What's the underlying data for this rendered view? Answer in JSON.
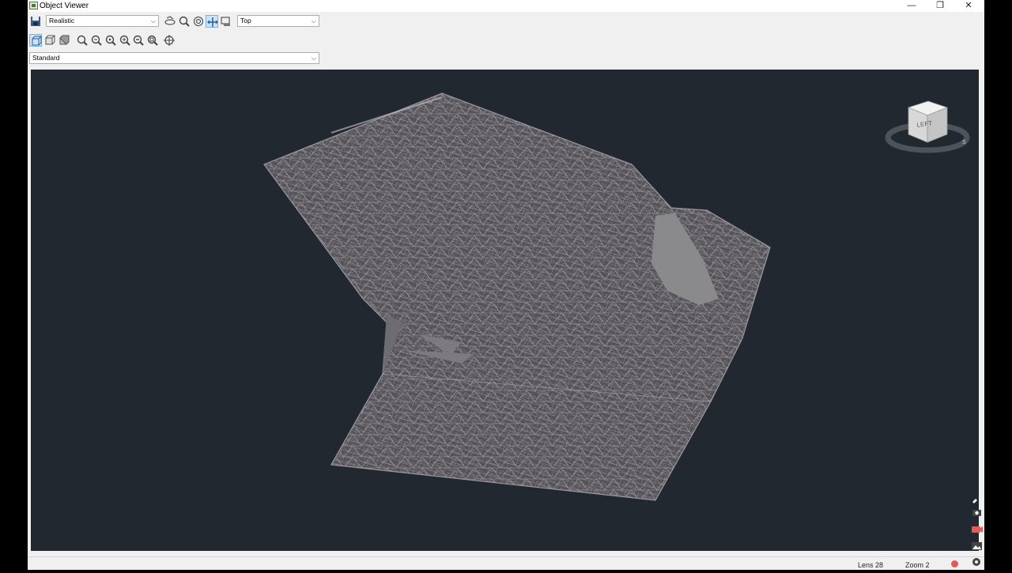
{
  "window": {
    "title": "Object Viewer",
    "controls": {
      "minimize": "—",
      "restore": "❐",
      "close": "✕"
    }
  },
  "toolbar": {
    "visual_style": "Realistic",
    "view": "Top",
    "ucs": "Standard",
    "icons_row1": [
      "save-icon",
      "orbit-icon",
      "zoom-icon",
      "zoom-window-icon",
      "pan-icon",
      "zoom-extents-icon"
    ],
    "icons_row2": [
      "wireframe-box-icon",
      "shaded-box-icon",
      "realistic-box-icon",
      "zoom-realtime-icon",
      "zoom-previous-icon",
      "zoom-dynamic-icon",
      "zoom-in-icon",
      "zoom-out-icon",
      "zoom-all-icon",
      "center-target-icon"
    ]
  },
  "viewcube": {
    "face_label": "LEFT",
    "compass_label": "S"
  },
  "status": {
    "lens": "Lens 28",
    "zoom": "Zoom 2"
  },
  "colors": {
    "viewport_bg": "#212830",
    "mesh_fill": "#5b5a5d",
    "mesh_line": "#a5a0aa",
    "flat_fill": "#888889",
    "record_red": "#e35a5a"
  },
  "side_tools": [
    "pin-icon",
    "camera-icon",
    "record-icon",
    "image-icon",
    "settings-icon"
  ]
}
